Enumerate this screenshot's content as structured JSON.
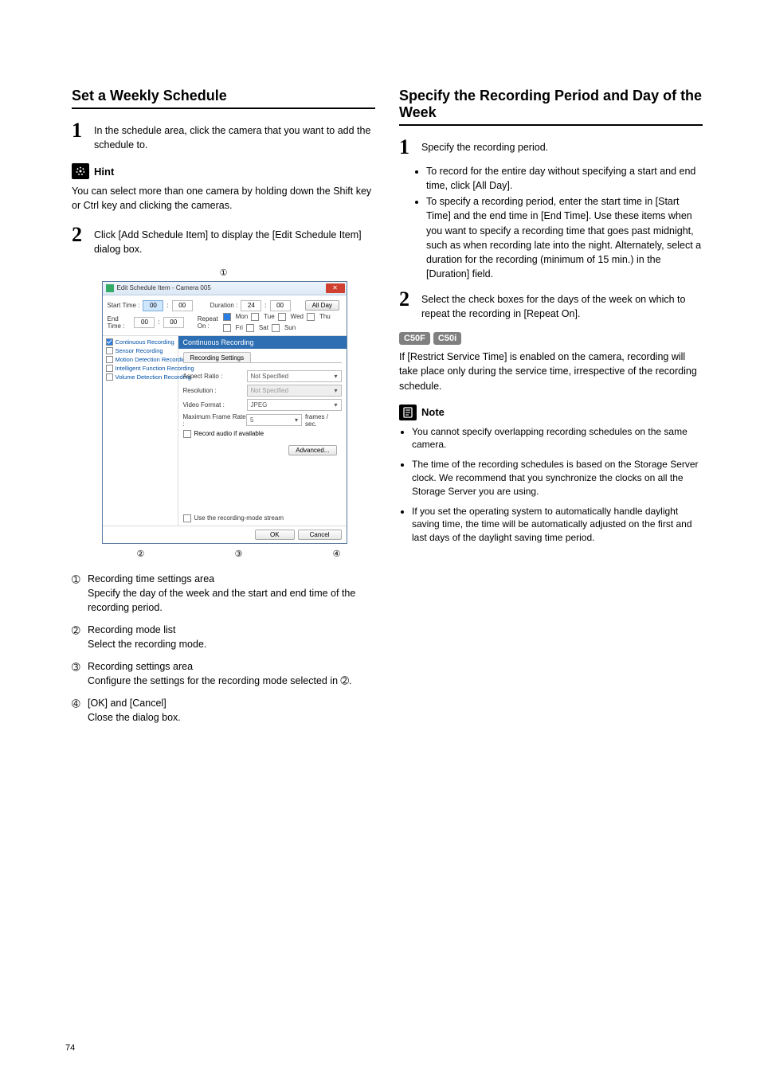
{
  "page_number": "74",
  "left": {
    "title": "Set a Weekly Schedule",
    "step1": "In the schedule area, click the camera that you want to add the schedule to.",
    "hint_label": "Hint",
    "hint_body": "You can select more than one camera by holding down the Shift key or Ctrl key and clicking the cameras.",
    "step2": "Click [Add Schedule Item] to display the [Edit Schedule Item] dialog box.",
    "callouts": {
      "c1": "①",
      "c2": "②",
      "c3": "③",
      "c4": "④"
    },
    "list": {
      "n1": {
        "num": "➀",
        "title": "Recording time settings area",
        "desc": "Specify the day of the week and the start and end time of the recording period."
      },
      "n2": {
        "num": "➁",
        "title": "Recording mode list",
        "desc": "Select the recording mode."
      },
      "n3": {
        "num": "➂",
        "title": "Recording settings area",
        "desc": "Configure the settings for the recording mode selected in ➁."
      },
      "n4": {
        "num": "➃",
        "title": "[OK] and [Cancel]",
        "desc": "Close the dialog box."
      }
    }
  },
  "right": {
    "title": "Specify the Recording Period and Day of the Week",
    "step1": "Specify the recording period.",
    "b1": "To record for the entire day without specifying a start and end time, click [All Day].",
    "b2": "To specify a recording period, enter the start time in [Start Time] and the end time in [End Time]. Use these items when you want to specify a recording time that goes past midnight, such as when recording late into the night. Alternately, select a duration for the recording (minimum of 15 min.) in the [Duration] field.",
    "step2": "Select the check boxes for the days of the week on which to repeat the recording in [Repeat On].",
    "badge1": "C50F",
    "badge2": "C50i",
    "badge_body": "If [Restrict Service Time] is enabled on the camera, recording will take place only during the service time, irrespective of the recording schedule.",
    "note_label": "Note",
    "note1": "You cannot specify overlapping recording schedules on the same camera.",
    "note2": "The time of the recording schedules is based on the Storage Server clock. We recommend that you synchronize the clocks on all the Storage Server you are using.",
    "note3": "If you set the operating system to automatically handle daylight saving time, the time will be automatically adjusted on the first and last days of the daylight saving time period."
  },
  "dialog": {
    "title": "Edit Schedule Item - Camera 005",
    "start_time": "Start Time :",
    "end_time": "End Time :",
    "duration": "Duration :",
    "start_hh": "00",
    "start_mm": "00",
    "end_hh": "00",
    "end_mm": "00",
    "dur_hh": "24",
    "dur_mm": "00",
    "allday": "All Day",
    "repeat_label": "Repeat On :",
    "days": [
      "Mon",
      "Tue",
      "Wed",
      "Thu",
      "Fri",
      "Sat",
      "Sun"
    ],
    "modes": [
      "Continuous Recording",
      "Sensor Recording",
      "Motion Detection Recording",
      "Intelligent Function Recording",
      "Volume Detection Recording"
    ],
    "blueheader": "Continuous Recording",
    "tab": "Recording Settings",
    "aspect_ratio_lbl": "Aspect Ratio :",
    "resolution_lbl": "Resolution :",
    "video_format_lbl": "Video Format :",
    "max_rate_lbl": "Maximum Frame Rate :",
    "not_specified": "Not Specified",
    "jpeg": "JPEG",
    "rate_val": "5",
    "rate_unit": "frames / sec.",
    "record_audio": "Record audio if available",
    "advanced": "Advanced...",
    "use_stream": "Use the recording-mode stream",
    "ok": "OK",
    "cancel": "Cancel"
  }
}
